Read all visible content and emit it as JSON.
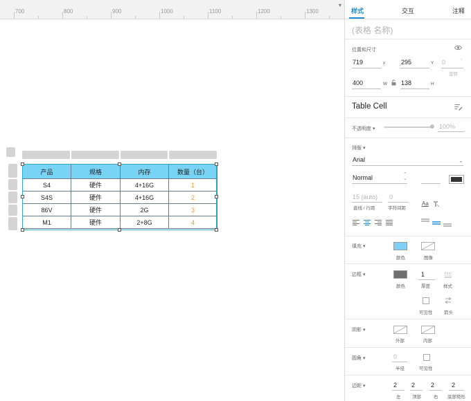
{
  "ruler": {
    "labels": [
      "700",
      "800",
      "900",
      "1000",
      "1100",
      "1200",
      "1300"
    ]
  },
  "table": {
    "headers": [
      "产品",
      "规格",
      "内存",
      "数量（台）"
    ],
    "rows": [
      [
        "S4",
        "硬件",
        "4+16G",
        "1"
      ],
      [
        "S4S",
        "硬件",
        "4+16G",
        "2"
      ],
      [
        "86V",
        "硬件",
        "2G",
        "3"
      ],
      [
        "M1",
        "硬件",
        "2+8G",
        "4"
      ]
    ]
  },
  "panel": {
    "tabs": [
      "样式",
      "交互",
      "注释"
    ],
    "name_placeholder": "(表格 名称)",
    "position_section": {
      "title": "位置和尺寸",
      "x": "719",
      "x_unit": "x",
      "y": "295",
      "y_unit": "Y",
      "rotation": "0",
      "rotation_unit": "°",
      "rotation_label": "旋转",
      "w": "400",
      "w_unit": "W",
      "h": "138",
      "h_unit": "H"
    },
    "component_title": "Table Cell",
    "opacity": {
      "label": "不透明度 ▾",
      "value": "100%"
    },
    "typography": {
      "label": "排版 ▾",
      "font": "Arial",
      "weight": "Normal",
      "text_color": "#333333",
      "line_height": "15 (auto)",
      "letter_spacing": "0",
      "line_height_label": "直线 / 行距",
      "letter_spacing_label": "字符间距",
      "aa_glyph": "Aa"
    },
    "fill": {
      "label": "填充 ▾",
      "color_label": "颜色",
      "image_label": "图像",
      "color": "#7ed1f5"
    },
    "border": {
      "label": "边框 ▾",
      "color_label": "颜色",
      "thickness": "1",
      "thickness_label": "厚度",
      "style_label": "样式",
      "visibility_label": "可见性",
      "arrow_label": "箭头",
      "color": "#6e6e6e"
    },
    "shadow": {
      "label": "阴影 ▾",
      "outer_label": "外部",
      "inner_label": "内部"
    },
    "corner": {
      "label": "圆角 ▾",
      "radius": "0",
      "radius_label": "半径",
      "visibility_label": "可见性"
    },
    "padding": {
      "label": "边距 ▾",
      "left": "2",
      "top": "2",
      "right": "2",
      "bottom": "2",
      "left_label": "左",
      "top_label": "顶部",
      "right_label": "右",
      "bottom_label": "底部矩形"
    }
  }
}
